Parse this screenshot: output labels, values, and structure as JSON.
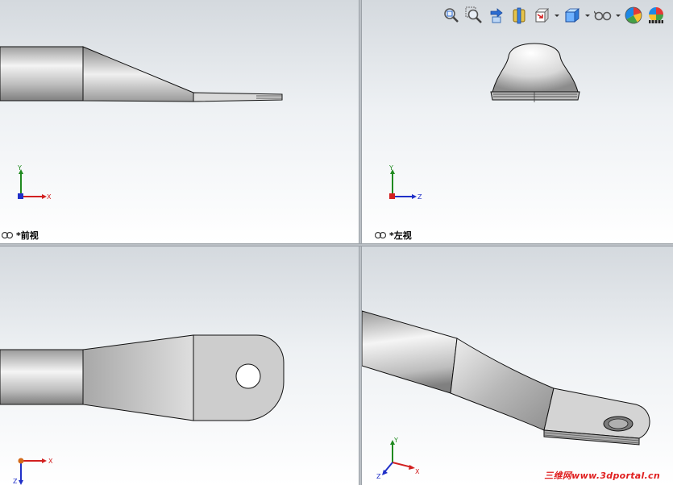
{
  "viewports": {
    "front": {
      "label": "*前视",
      "triad_axes": [
        "Y",
        "X"
      ]
    },
    "left": {
      "label": "*左视",
      "triad_axes": [
        "Y",
        "Z"
      ]
    },
    "top": {
      "triad_axes": [
        "Z",
        "X"
      ]
    },
    "iso": {
      "triad_axes": [
        "Y",
        "Z",
        "X"
      ]
    }
  },
  "toolbar": {
    "buttons": [
      {
        "icon": "zoom-to-fit-icon"
      },
      {
        "icon": "zoom-to-area-icon"
      },
      {
        "icon": "previous-view-icon"
      },
      {
        "icon": "section-view-icon"
      },
      {
        "icon": "view-orientation-icon",
        "dropdown": true
      },
      {
        "icon": "display-style-icon",
        "dropdown": true
      },
      {
        "icon": "hide-show-items-icon",
        "dropdown": true
      },
      {
        "icon": "edit-appearance-icon"
      },
      {
        "icon": "apply-scene-icon"
      }
    ]
  },
  "watermark": "三维网www.3dportal.cn",
  "colors": {
    "axis_x": "#d22020",
    "axis_y": "#1f8a1f",
    "axis_z": "#2030c8",
    "part": "#cfcfcf"
  }
}
